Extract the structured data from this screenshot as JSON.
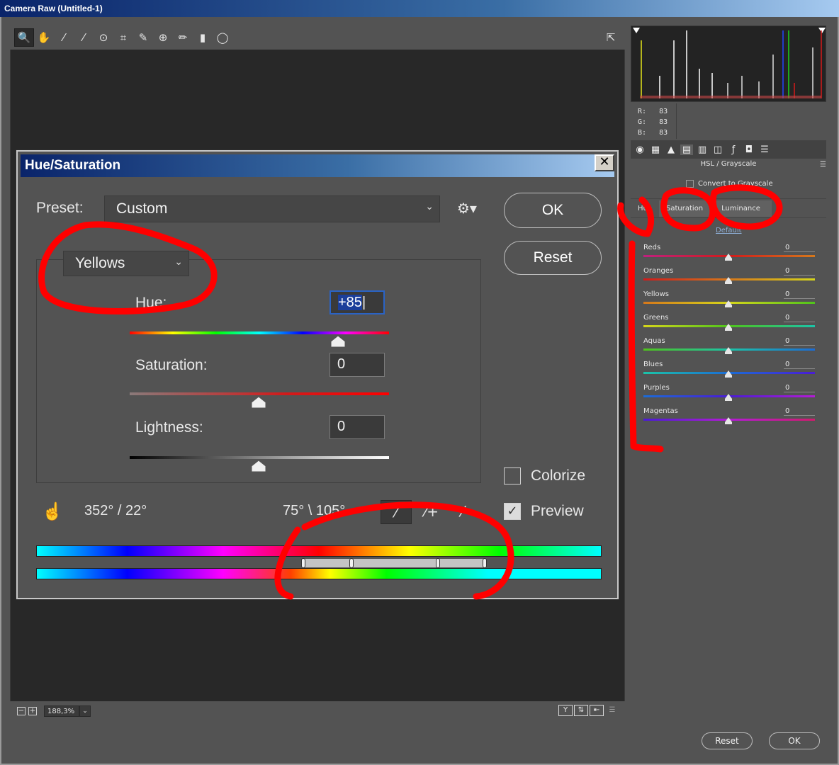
{
  "window": {
    "title": "Camera Raw (Untitled-1)"
  },
  "toolbar": {
    "tools": [
      "zoom-icon",
      "hand-icon",
      "white-balance-icon",
      "color-sampler-icon",
      "target-adjust-icon",
      "crop-icon",
      "spot-removal-icon",
      "red-eye-icon",
      "brush-icon",
      "graduated-filter-icon",
      "radial-filter-icon"
    ],
    "fullscreen_icon": "fullscreen-icon"
  },
  "bottom_bar": {
    "zoom_minus": "−",
    "zoom_plus": "+",
    "zoom_value": "188,3%",
    "view_toggle": "Y"
  },
  "info": {
    "r_label": "R:",
    "g_label": "G:",
    "b_label": "B:",
    "r": "83",
    "g": "83",
    "b": "83"
  },
  "hsl_panel": {
    "title": "HSL / Grayscale",
    "convert_label": "Convert to Grayscale",
    "tabs": [
      "Hue",
      "Saturation",
      "Luminance"
    ],
    "default_link": "Default",
    "sliders": [
      {
        "label": "Reds",
        "value": "0",
        "gradient": "linear-gradient(to right,#c0207e,#d11b1b,#d6781b)"
      },
      {
        "label": "Oranges",
        "value": "0",
        "gradient": "linear-gradient(to right,#d11b1b,#d6781b,#d6d61b)"
      },
      {
        "label": "Yellows",
        "value": "0",
        "gradient": "linear-gradient(to right,#d6781b,#d6d61b,#4fc41b)"
      },
      {
        "label": "Greens",
        "value": "0",
        "gradient": "linear-gradient(to right,#d6d61b,#4fc41b,#1bc4a8)"
      },
      {
        "label": "Aquas",
        "value": "0",
        "gradient": "linear-gradient(to right,#4fc41b,#1bc4a8,#1b6cd6)"
      },
      {
        "label": "Blues",
        "value": "0",
        "gradient": "linear-gradient(to right,#1bc4a8,#1b6cd6,#4a1bd6)"
      },
      {
        "label": "Purples",
        "value": "0",
        "gradient": "linear-gradient(to right,#1b6cd6,#4a1bd6,#b41bd6)"
      },
      {
        "label": "Magentas",
        "value": "0",
        "gradient": "linear-gradient(to right,#4a1bd6,#b41bd6,#d11b6e)"
      }
    ]
  },
  "window_buttons": {
    "reset": "Reset",
    "ok": "OK"
  },
  "dialog": {
    "title": "Hue/Saturation",
    "close": "✕",
    "preset_label": "Preset:",
    "preset_value": "Custom",
    "ok": "OK",
    "reset": "Reset",
    "channel": "Yellows",
    "hue_label": "Hue:",
    "hue_value": "+85",
    "saturation_label": "Saturation:",
    "saturation_value": "0",
    "lightness_label": "Lightness:",
    "lightness_value": "0",
    "colorize_label": "Colorize",
    "preview_label": "Preview",
    "angle_left": "352° / 22°",
    "angle_right": "75° \\ 105°"
  },
  "colors": {
    "accent": "#2a63c5",
    "annotation": "#ff0000"
  }
}
